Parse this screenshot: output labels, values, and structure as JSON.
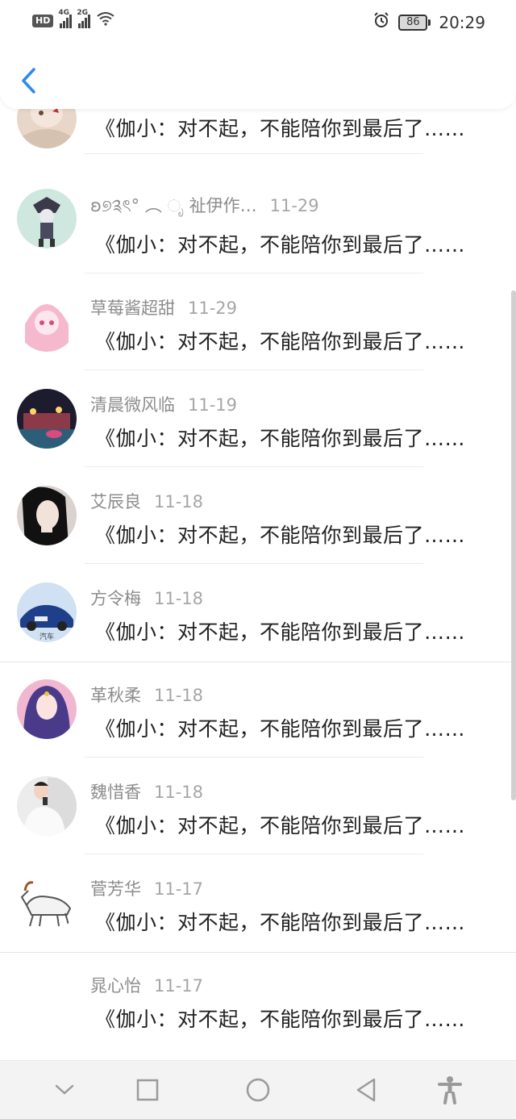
{
  "status_bar": {
    "hd": "HD",
    "net1": "4G",
    "net2": "2G",
    "battery": "86",
    "time": "20:29"
  },
  "header": {
    "back_icon": "chevron-left-icon"
  },
  "comments": [
    {
      "name": "",
      "date": "",
      "message": "《伽小：对不起，不能陪你到最后了……"
    },
    {
      "name": "ʚ୭༉ৎ° ︵ ೃ 祉伊作…",
      "date": "11-29",
      "message": "《伽小：对不起，不能陪你到最后了……"
    },
    {
      "name": "草莓酱超甜",
      "date": "11-29",
      "message": "《伽小：对不起，不能陪你到最后了……"
    },
    {
      "name": "清晨微风临",
      "date": "11-19",
      "message": "《伽小：对不起，不能陪你到最后了……"
    },
    {
      "name": "艾辰良",
      "date": "11-18",
      "message": "《伽小：对不起，不能陪你到最后了……"
    },
    {
      "name": "方令梅",
      "date": "11-18",
      "message": "《伽小：对不起，不能陪你到最后了……"
    },
    {
      "name": "革秋柔",
      "date": "11-18",
      "message": "《伽小：对不起，不能陪你到最后了……"
    },
    {
      "name": "魏惜香",
      "date": "11-18",
      "message": "《伽小：对不起，不能陪你到最后了……"
    },
    {
      "name": "菅芳华",
      "date": "11-17",
      "message": "《伽小：对不起，不能陪你到最后了……"
    },
    {
      "name": "晁心怡",
      "date": "11-17",
      "message": "《伽小：对不起，不能陪你到最后了……"
    }
  ],
  "avatar_caption": "汽车",
  "nav": {
    "items": [
      "chevron-down-icon",
      "square-icon",
      "circle-icon",
      "triangle-back-icon",
      "accessibility-icon"
    ]
  },
  "colors": {
    "accent": "#2b8be8",
    "text": "#222222",
    "meta": "#8c8c8c"
  }
}
